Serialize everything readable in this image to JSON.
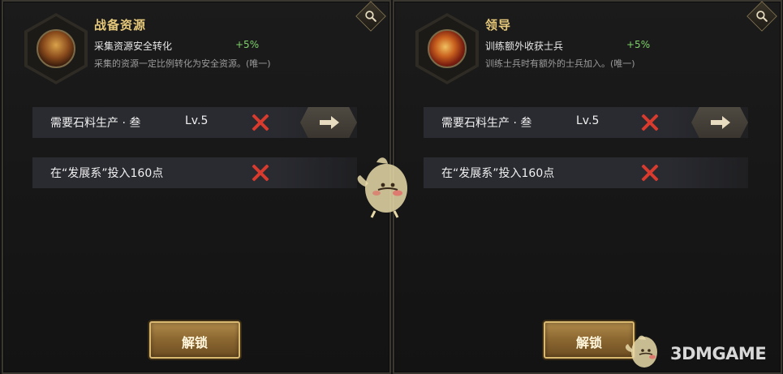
{
  "panels": [
    {
      "title": "战备资源",
      "subtitle": "采集资源安全转化",
      "bonus": "+5%",
      "description": "采集的资源一定比例转化为安全资源。(唯一)",
      "icon": "resource-chest-icon",
      "requirements": [
        {
          "text": "需要石料生产 · 叁",
          "level": "Lv.5",
          "met": false,
          "has_goto": true
        },
        {
          "text": "在“发展系”投入160点",
          "level": "",
          "met": false,
          "has_goto": false
        }
      ],
      "unlock_label": "解锁"
    },
    {
      "title": "领导",
      "subtitle": "训练额外收获士兵",
      "bonus": "+5%",
      "description": "训练士兵时有额外的士兵加入。(唯一)",
      "icon": "leadership-fist-icon",
      "requirements": [
        {
          "text": "需要石料生产 · 叁",
          "level": "Lv.5",
          "met": false,
          "has_goto": true
        },
        {
          "text": "在“发展系”投入160点",
          "level": "",
          "met": false,
          "has_goto": false
        }
      ],
      "unlock_label": "解锁"
    }
  ],
  "watermark": {
    "text": "3DMGAME"
  },
  "colors": {
    "title": "#e6c87a",
    "bonus": "#7ed26a",
    "unmet": "#d83a2e",
    "button": "#8a6630"
  }
}
